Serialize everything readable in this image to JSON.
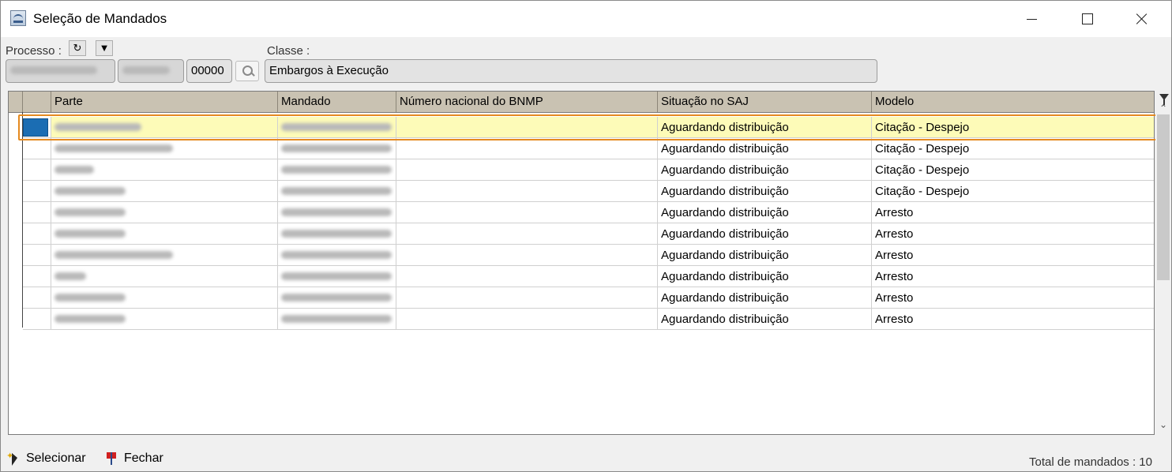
{
  "window": {
    "title": "Seleção de Mandados"
  },
  "processo": {
    "label": "Processo :",
    "field1": "",
    "field2": "",
    "field3": "00000"
  },
  "classe": {
    "label": "Classe :",
    "value": "Embargos à Execução"
  },
  "grid": {
    "columns": [
      "",
      "Parte",
      "Mandado",
      "Número nacional do BNMP",
      "Situação no SAJ",
      "Modelo"
    ],
    "rows": [
      {
        "parte": "",
        "mandado": "",
        "bnmp": "",
        "situacao": "Aguardando distribuição",
        "modelo": "Citação - Despejo"
      },
      {
        "parte": "",
        "mandado": "",
        "bnmp": "",
        "situacao": "Aguardando distribuição",
        "modelo": "Citação - Despejo"
      },
      {
        "parte": "",
        "mandado": "",
        "bnmp": "",
        "situacao": "Aguardando distribuição",
        "modelo": "Citação - Despejo"
      },
      {
        "parte": "",
        "mandado": "",
        "bnmp": "",
        "situacao": "Aguardando distribuição",
        "modelo": "Citação - Despejo"
      },
      {
        "parte": "",
        "mandado": "",
        "bnmp": "",
        "situacao": "Aguardando distribuição",
        "modelo": "Arresto"
      },
      {
        "parte": "",
        "mandado": "",
        "bnmp": "",
        "situacao": "Aguardando distribuição",
        "modelo": "Arresto"
      },
      {
        "parte": "",
        "mandado": "",
        "bnmp": "",
        "situacao": "Aguardando distribuição",
        "modelo": "Arresto"
      },
      {
        "parte": "",
        "mandado": "",
        "bnmp": "",
        "situacao": "Aguardando distribuição",
        "modelo": "Arresto"
      },
      {
        "parte": "",
        "mandado": "",
        "bnmp": "",
        "situacao": "Aguardando distribuição",
        "modelo": "Arresto"
      },
      {
        "parte": "",
        "mandado": "",
        "bnmp": "",
        "situacao": "Aguardando distribuição",
        "modelo": "Arresto"
      }
    ]
  },
  "footer": {
    "select_label": "Selecionar",
    "close_label": "Fechar",
    "total": "Total de mandados : 10"
  },
  "colors": {
    "header_bg": "#c9c2b2",
    "selected_row": "#fdfbb8",
    "highlight": "#e58a1f",
    "row_marker": "#1b6db3"
  }
}
